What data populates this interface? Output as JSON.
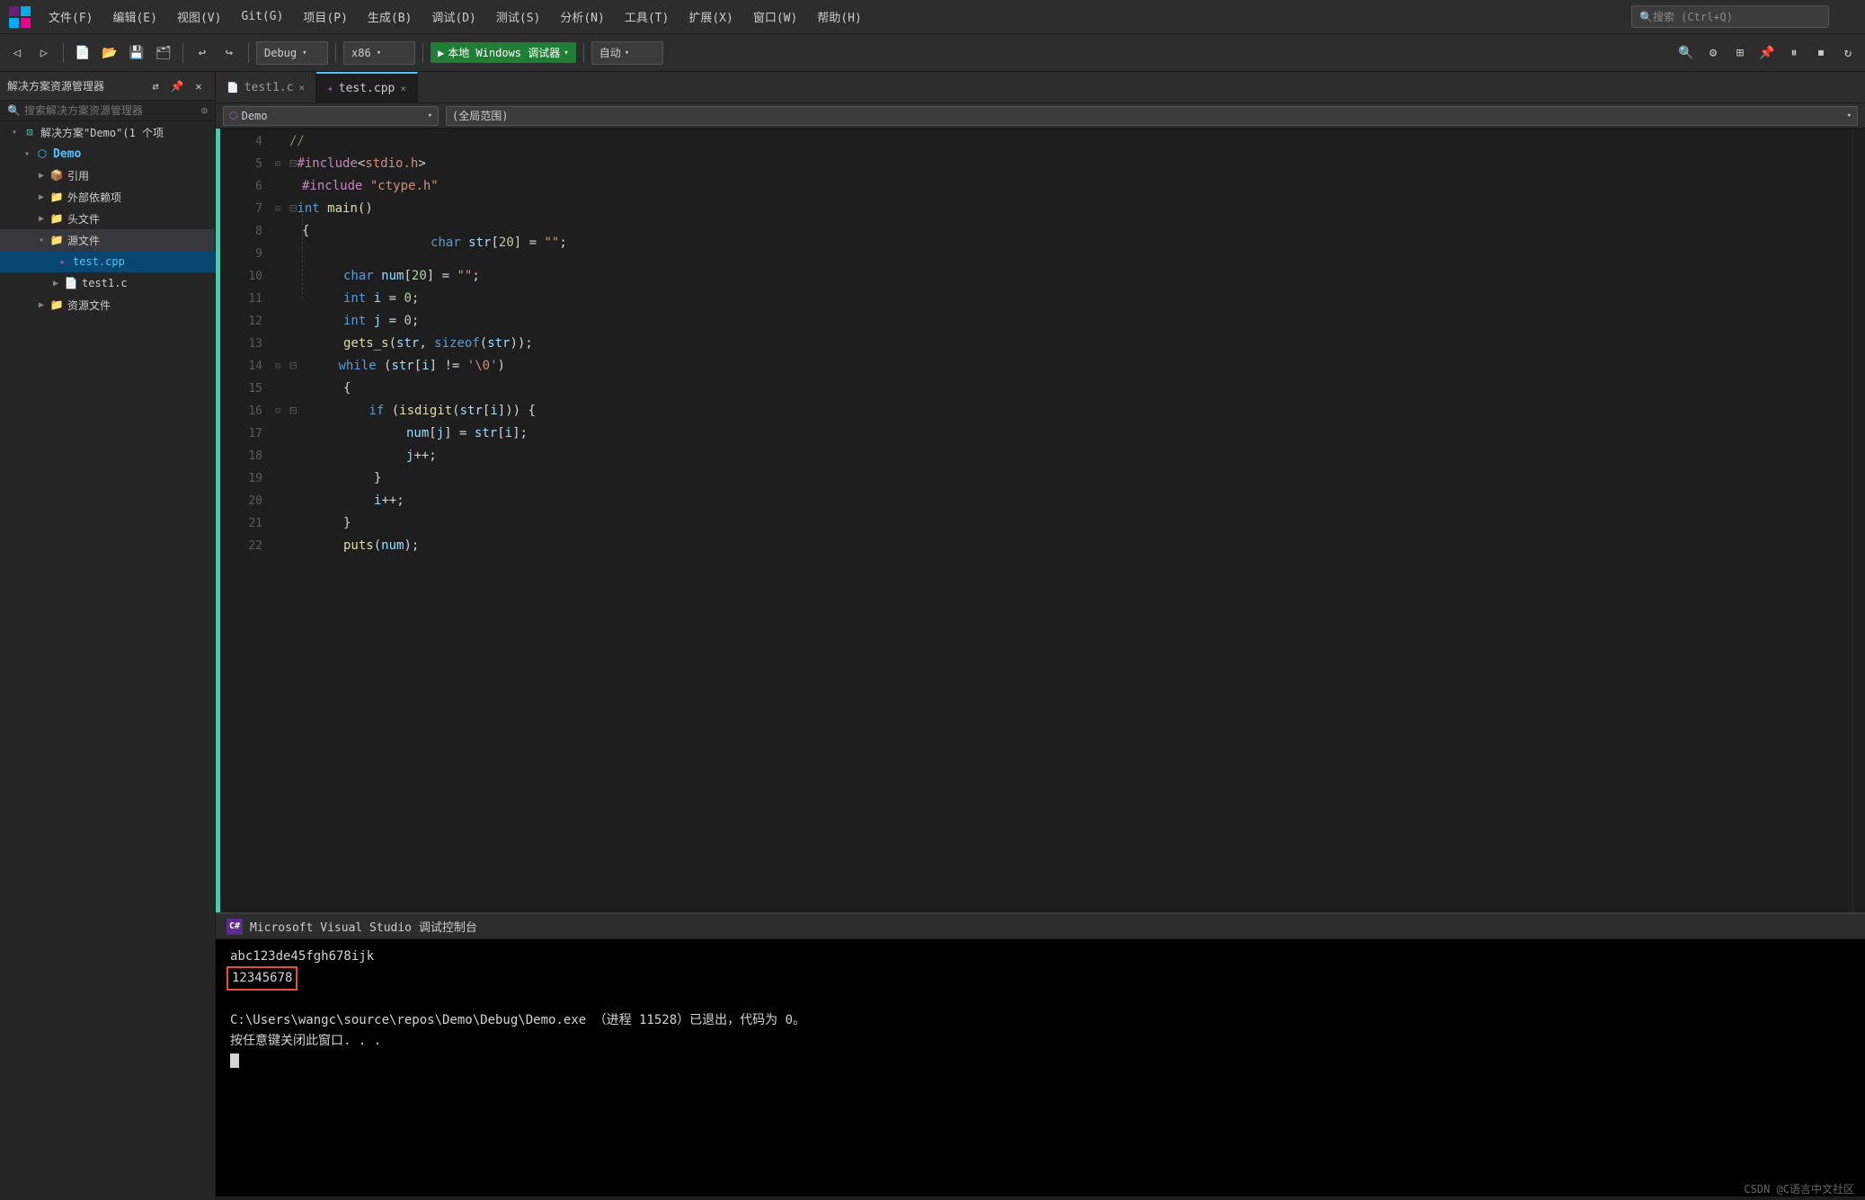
{
  "menubar": {
    "items": [
      "文件(F)",
      "编辑(E)",
      "视图(V)",
      "Git(G)",
      "项目(P)",
      "生成(B)",
      "调试(D)",
      "测试(S)",
      "分析(N)",
      "工具(T)",
      "扩展(X)",
      "窗口(W)",
      "帮助(H)"
    ],
    "search_placeholder": "搜索 (Ctrl+Q)"
  },
  "toolbar": {
    "debug_config": "Debug",
    "platform": "x86",
    "debug_target": "本地 Windows 调试器",
    "auto_label": "自动"
  },
  "sidebar": {
    "title": "解决方案资源管理器",
    "search_placeholder": "搜索解决方案资源管理器",
    "solution_label": "解决方案\"Demo\"(1 个项",
    "demo_label": "Demo",
    "ref_label": "引用",
    "ext_dep_label": "外部依赖项",
    "header_label": "头文件",
    "source_label": "源文件",
    "test_cpp_label": "test.cpp",
    "test1_c_label": "test1.c",
    "resource_label": "资源文件"
  },
  "tabs": [
    {
      "label": "test1.c",
      "active": false,
      "modified": false
    },
    {
      "label": "test.cpp",
      "active": true,
      "modified": false
    }
  ],
  "nav": {
    "left": "Demo",
    "right": "(全局范围)"
  },
  "code": {
    "lines": [
      {
        "num": 4,
        "content": "//",
        "type": "comment"
      },
      {
        "num": 5,
        "content": "#include<stdio.h>",
        "type": "include"
      },
      {
        "num": 6,
        "content": "#include \"ctype.h\"",
        "type": "include"
      },
      {
        "num": 7,
        "content": "int main()",
        "type": "function"
      },
      {
        "num": 8,
        "content": "{",
        "type": "brace"
      },
      {
        "num": 9,
        "content": "    char str[20] = \"\";",
        "type": "code"
      },
      {
        "num": 10,
        "content": "    char num[20] = \"\";",
        "type": "code"
      },
      {
        "num": 11,
        "content": "    int i = 0;",
        "type": "code"
      },
      {
        "num": 12,
        "content": "    int j = 0;",
        "type": "code"
      },
      {
        "num": 13,
        "content": "    gets_s(str, sizeof(str));",
        "type": "code"
      },
      {
        "num": 14,
        "content": "    while (str[i] != '\\0')",
        "type": "code"
      },
      {
        "num": 15,
        "content": "    {",
        "type": "code"
      },
      {
        "num": 16,
        "content": "        if (isdigit(str[i])) {",
        "type": "code"
      },
      {
        "num": 17,
        "content": "            num[j] = str[i];",
        "type": "code"
      },
      {
        "num": 18,
        "content": "            j++;",
        "type": "code"
      },
      {
        "num": 19,
        "content": "        }",
        "type": "code"
      },
      {
        "num": 20,
        "content": "        i++;",
        "type": "code"
      },
      {
        "num": 21,
        "content": "    }",
        "type": "code"
      },
      {
        "num": 22,
        "content": "    puts(num);",
        "type": "code"
      }
    ]
  },
  "console": {
    "title": "Microsoft Visual Studio 调试控制台",
    "output1": "abc123de45fgh678ijk",
    "output2": "12345678",
    "output3": "C:\\Users\\wangc\\source\\repos\\Demo\\Debug\\Demo.exe （进程 11528）已退出，代码为 0。",
    "output4": "按任意键关闭此窗口. . ."
  },
  "branding": "CSDN @C语言中文社区"
}
